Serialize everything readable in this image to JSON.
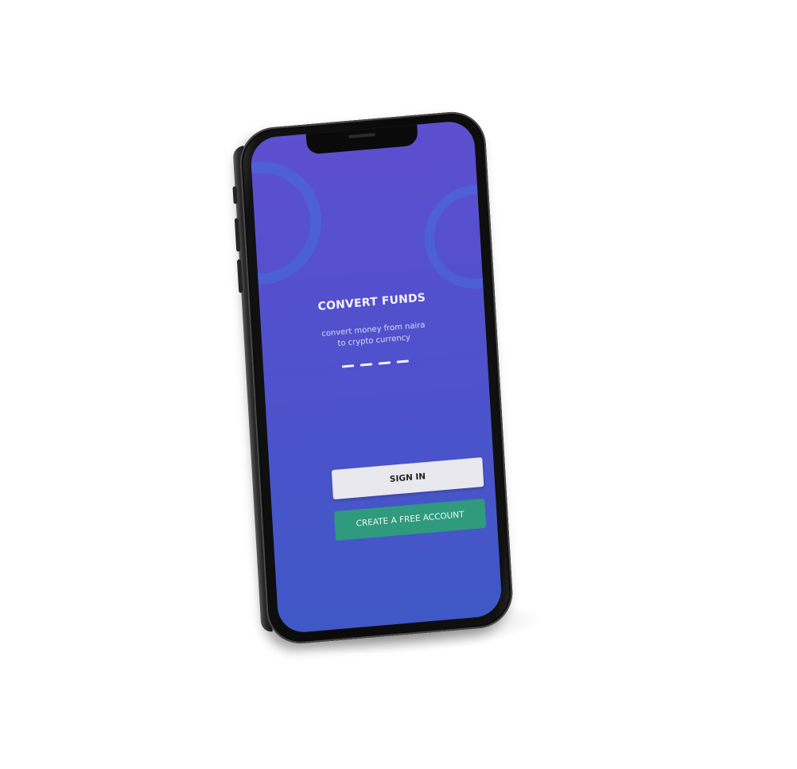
{
  "screen": {
    "title": "CONVERT FUNDS",
    "subtitle": "convert money from naira to crypto currency",
    "page_indicator_count": 4
  },
  "actions": {
    "sign_in_label": "SIGN IN",
    "create_account_label": "CREATE A FREE ACCOUNT"
  },
  "colors": {
    "screen_background_top": "#5d4fcf",
    "screen_background_bottom": "#3f58c6",
    "sign_in_button": "#e8e8ee",
    "create_account_button": "#2f9a7d",
    "decorative_ring": "#466edc",
    "phone_frame": "#0a0a0a"
  }
}
